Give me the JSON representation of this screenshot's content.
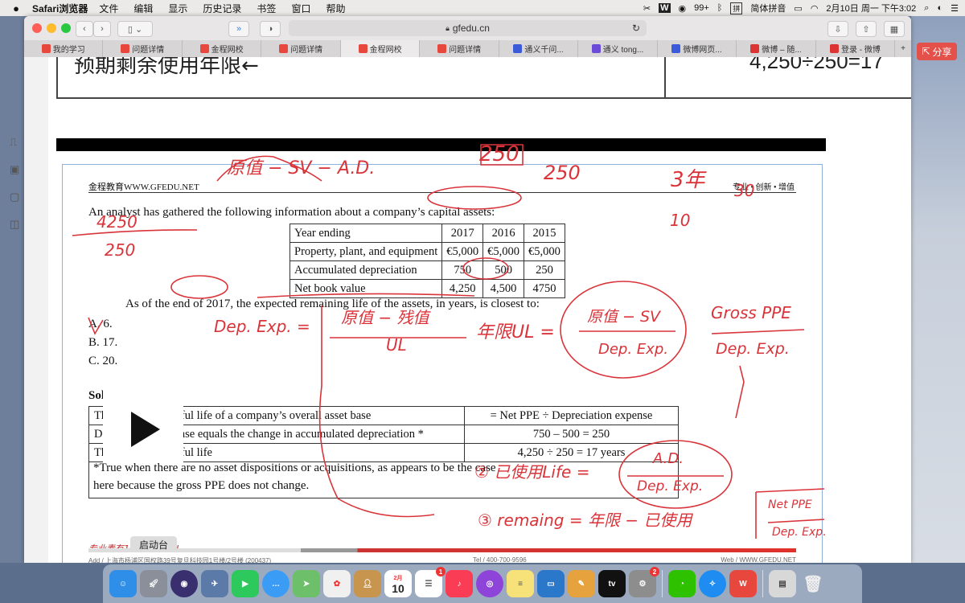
{
  "menubar": {
    "app_name": "Safari浏览器",
    "menus": [
      "文件",
      "编辑",
      "显示",
      "历史记录",
      "书签",
      "窗口",
      "帮助"
    ],
    "battery_label": "99+",
    "input_method": "简体拼音",
    "datetime": "2月10日 周一 下午3:02"
  },
  "browser": {
    "url": "gfedu.cn",
    "tabs": [
      {
        "label": "我的学习",
        "favicon_color": "#e8473d"
      },
      {
        "label": "问题详情",
        "favicon_color": "#e8473d"
      },
      {
        "label": "金程网校",
        "favicon_color": "#e8473d"
      },
      {
        "label": "问题详情",
        "favicon_color": "#e8473d"
      },
      {
        "label": "金程网校",
        "favicon_color": "#e8473d",
        "active": true
      },
      {
        "label": "问题详情",
        "favicon_color": "#e8473d"
      },
      {
        "label": "通义千问...",
        "favicon_color": "#3b5bdb"
      },
      {
        "label": "通义 tong...",
        "favicon_color": "#6b4bd8"
      },
      {
        "label": "微博网页...",
        "favicon_color": "#3b5bdb"
      },
      {
        "label": "微博 – 随...",
        "favicon_color": "#d33"
      },
      {
        "label": "登录 - 微博",
        "favicon_color": "#d33"
      }
    ],
    "share_label": "分享"
  },
  "page": {
    "top_left_text": "预期剩余使用年限←",
    "top_right_text": "4,250÷250=17",
    "doc": {
      "header_left": "金程教育WWW.GFEDU.NET",
      "header_right": "专业 • 创新 • 增值",
      "intro": "An analyst has gathered the following information about a company’s capital assets:",
      "table": {
        "headers": [
          "Year ending",
          "2017",
          "2016",
          "2015"
        ],
        "rows": [
          [
            "Property, plant, and equipment",
            "€5,000",
            "€5,000",
            "€5,000"
          ],
          [
            "Accumulated depreciation",
            "750",
            "500",
            "250"
          ],
          [
            "Net book value",
            "4,250",
            "4,500",
            "4750"
          ]
        ]
      },
      "question": "As of the end of 2017, the expected remaining life of the assets, in years, is closest to:",
      "options": [
        "A.  6.",
        "B.  17.",
        "C.  20."
      ],
      "solution_title": "Solution: B.",
      "solution_rows": [
        [
          "The remaining useful life of a company’s overall asset base",
          "= Net PPE ÷ Depreciation expense"
        ],
        [
          "Depreciation expense equals the change in accumulated depreciation *",
          "750 – 500 = 250"
        ],
        [
          "The remaining useful life",
          "4,250 ÷ 250 = 17 years"
        ]
      ],
      "footnote_line1": "*True when there are no asset dispositions or acquisitions, as appears to be the case",
      "footnote_line2": "here because the gross PPE does not change.",
      "footer_slogan": "专业素有101%的投入!",
      "footer_addr": "Add / 上海市杨浦区国权路39号复旦科技园1号楼/2号楼 (200437)",
      "footer_tel": "Tel / 400-700-9596",
      "footer_web": "Web / WWW.GFEDU.NET"
    }
  },
  "handwriting": {
    "top_formula": "原值 − SV − A.D.",
    "frac_num": "4250",
    "frac_den": "250",
    "frac2_top": "250",
    "frac2_bottom": "250",
    "year_note": "3年",
    "num_30": "30",
    "num_10": "10",
    "dep_exp_label": "Dep. Exp. =",
    "dep_num": "原值 − 残值",
    "dep_den": "UL",
    "ul_label": "年限UL =",
    "ul_num": "原值 − SV",
    "ul_den": "Dep. Exp.",
    "gross_num": "Gross PPE",
    "gross_den": "Dep. Exp.",
    "used_label": "② 已使用Life =",
    "used_num": "A.D.",
    "used_den": "Dep. Exp.",
    "remain_label": "③ remaing = 年限 − 已使用",
    "netppe_num": "Net PPE",
    "netppe_den": "Dep. Exp."
  },
  "overlay": {
    "launch_tooltip": "启动台"
  },
  "dock": {
    "calendar_day": "10",
    "calendar_month": "2月",
    "reminders_badge": "1",
    "settings_badge": "2",
    "tv_label": "tv"
  }
}
